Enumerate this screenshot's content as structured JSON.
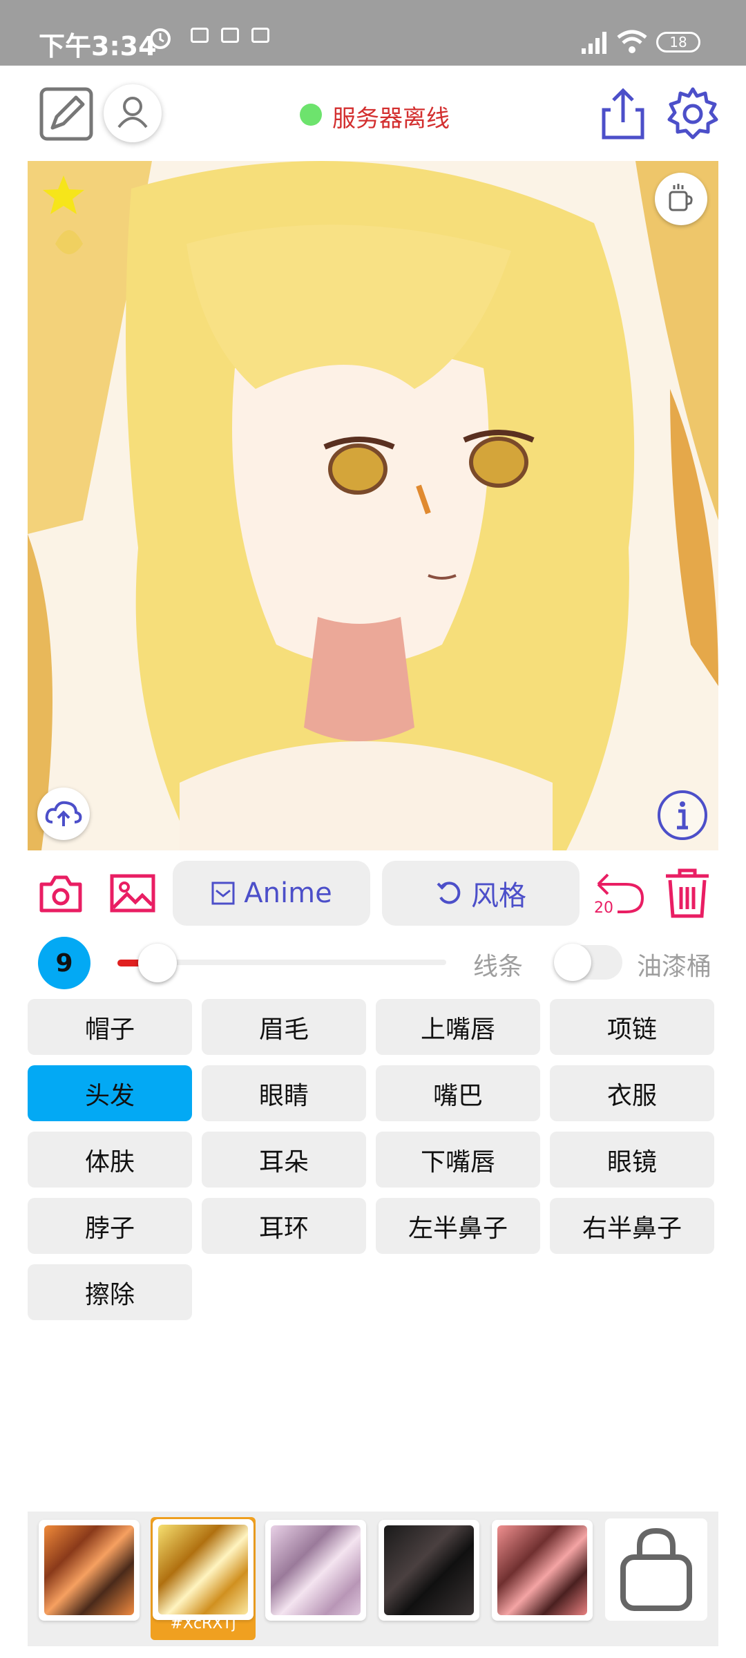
{
  "status_bar": {
    "time": "下午3:34",
    "battery": "18"
  },
  "header": {
    "server_status": "服务器离线",
    "server_color": "#6de36d"
  },
  "toolbar": {
    "anime_label": "Anime",
    "style_label": "风格",
    "undo_count": "20"
  },
  "brush": {
    "size": "9",
    "lines_label": "线条",
    "bucket_label": "油漆桶",
    "slider_fraction": 0.1,
    "bucket_enabled": false
  },
  "parts": [
    "帽子",
    "眉毛",
    "上嘴唇",
    "项链",
    "头发",
    "眼睛",
    "嘴巴",
    "衣服",
    "体肤",
    "耳朵",
    "下嘴唇",
    "眼镜",
    "脖子",
    "耳环",
    "左半鼻子",
    "右半鼻子",
    "擦除"
  ],
  "selected_part": "头发",
  "palette": {
    "selected_code": "#XcRXTj"
  },
  "colors": {
    "accent_blue": "#03a9f4",
    "icon_purple": "#4c4fc9",
    "icon_pink": "#e91e63"
  }
}
